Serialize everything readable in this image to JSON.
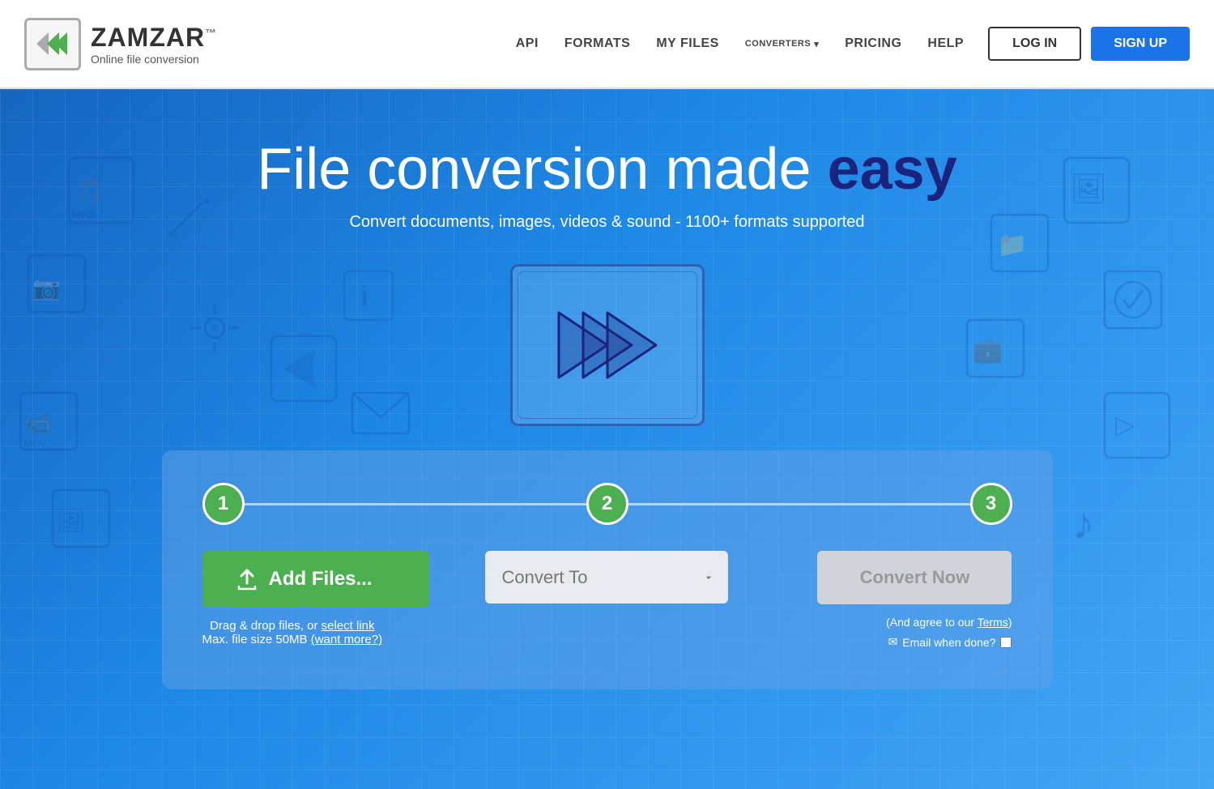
{
  "navbar": {
    "logo_brand": "ZAMZAR",
    "logo_tm": "™",
    "logo_tagline": "Online file conversion",
    "nav_links": [
      {
        "id": "api",
        "label": "API"
      },
      {
        "id": "formats",
        "label": "FORMATS"
      },
      {
        "id": "my-files",
        "label": "MY FILES"
      },
      {
        "id": "converters",
        "label": "CONVERTERS",
        "has_dropdown": true
      },
      {
        "id": "pricing",
        "label": "PRICING"
      },
      {
        "id": "help",
        "label": "HELP"
      }
    ],
    "login_label": "LOG IN",
    "signup_label": "SIGN UP"
  },
  "hero": {
    "title_prefix": "File ",
    "title_accent": "conversion",
    "title_suffix": " made ",
    "title_bold": "easy",
    "subtitle": "Convert documents, images, videos & sound - 1100+ formats supported"
  },
  "form": {
    "step1": "1",
    "step2": "2",
    "step3": "3",
    "add_files_label": "Add Files...",
    "drag_drop_text": "Drag & drop files, or ",
    "select_link_label": "select link",
    "max_size_text": "Max. file size 50MB ",
    "want_more_label": "(want more?)",
    "convert_to_placeholder": "Convert To",
    "convert_now_label": "Convert Now",
    "agree_text": "(And agree to our ",
    "terms_label": "Terms",
    "agree_close": ")",
    "email_label": "Email when done?"
  }
}
